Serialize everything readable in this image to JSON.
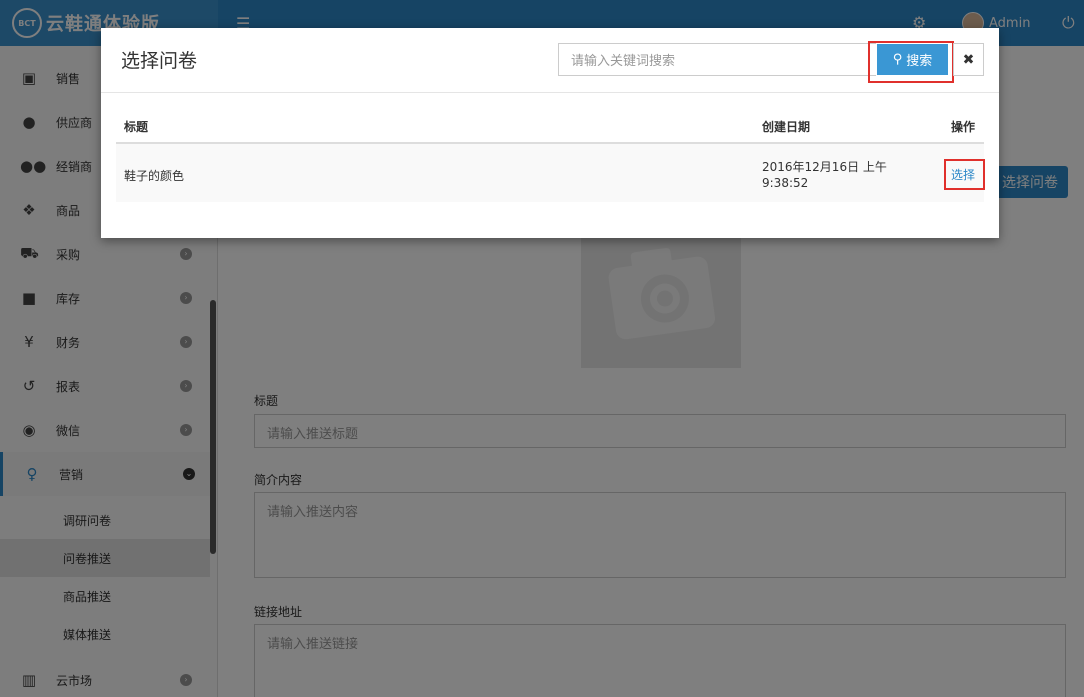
{
  "header": {
    "logo_badge": "BCT",
    "app_name": "云鞋通体验版",
    "username": "Admin"
  },
  "sidebar": {
    "items": [
      {
        "label": "销售",
        "icon": "money-icon"
      },
      {
        "label": "供应商",
        "icon": "user-icon"
      },
      {
        "label": "经销商",
        "icon": "users-icon"
      },
      {
        "label": "商品",
        "icon": "cubes-icon"
      },
      {
        "label": "采购",
        "icon": "cart-icon"
      },
      {
        "label": "库存",
        "icon": "archive-icon"
      },
      {
        "label": "财务",
        "icon": "yen-icon"
      },
      {
        "label": "报表",
        "icon": "history-icon"
      },
      {
        "label": "微信",
        "icon": "wechat-icon"
      },
      {
        "label": "营销",
        "icon": "lightbulb-icon"
      },
      {
        "label": "云市场",
        "icon": "building-icon"
      }
    ],
    "sub_items": [
      "调研问卷",
      "问卷推送",
      "商品推送",
      "媒体推送"
    ],
    "active_item": "营销",
    "active_sub_item": "问卷推送"
  },
  "page": {
    "pick_button": "选择问卷",
    "title_label": "标题",
    "title_placeholder": "请输入推送标题",
    "summary_label": "简介内容",
    "summary_placeholder": "请输入推送内容",
    "link_label": "链接地址",
    "link_placeholder": "请输入推送链接"
  },
  "modal": {
    "title": "选择问卷",
    "search_placeholder": "请输入关键词搜索",
    "search_button": "搜索",
    "columns": [
      "标题",
      "创建日期",
      "操作"
    ],
    "rows": [
      {
        "title": "鞋子的颜色",
        "date_line1": "2016年12月16日 上午",
        "date_line2": "9:38:52",
        "action": "选择"
      }
    ]
  },
  "colors": {
    "header": "#2d88c8",
    "accent": "#3a97d4",
    "highlight": "#e0302c"
  }
}
